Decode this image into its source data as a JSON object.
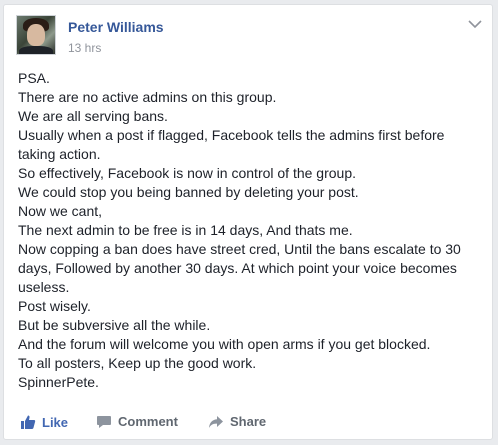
{
  "post": {
    "author": "Peter Williams",
    "time": "13 hrs",
    "lines": [
      "PSA.",
      "There are no active admins on this group.",
      "We are all serving bans.",
      "Usually when a post if flagged, Facebook tells the admins first before",
      "taking action.",
      "So effectively, Facebook is now in control of the group.",
      "We could stop you being banned by deleting your post.",
      "Now we cant,",
      "The next admin to be free is in 14 days, And thats me.",
      "Now copping a ban does have street cred, Until the bans escalate to 30",
      "days, Followed by another 30 days. At which point your voice becomes",
      "useless.",
      "Post wisely.",
      "But be subversive all the while.",
      "And the forum will welcome you with open arms if you get blocked.",
      "To all posters, Keep up the good work.",
      "SpinnerPete."
    ]
  },
  "actions": {
    "like": "Like",
    "comment": "Comment",
    "share": "Share"
  },
  "colors": {
    "link": "#365899",
    "like": "#4267b2",
    "muted": "#90949c",
    "text": "#1d2129"
  }
}
